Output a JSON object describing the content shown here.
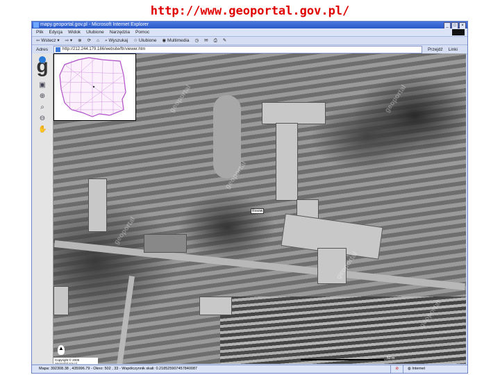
{
  "caption": "http://www.geoportal.gov.pl/",
  "window": {
    "title": "mapy.geoportal.gov.pl - Microsoft Internet Explorer",
    "controls": [
      "_",
      "□",
      "×"
    ]
  },
  "menu": [
    "Plik",
    "Edycja",
    "Widok",
    "Ulubione",
    "Narzędzia",
    "Pomoc"
  ],
  "toolbar": {
    "back": "Wstecz",
    "search": "Wyszukaj",
    "favorites": "Ulubione",
    "media": "Multimedia"
  },
  "address": {
    "label": "Adres",
    "url": "http://212.244.179.186/website/ftr/viewer.htm",
    "go": "Przejdź",
    "links": "Linki"
  },
  "map": {
    "place_label": "Rosow",
    "copyright": "Copyright © 2005 geoportal.gov.pl",
    "scale_label": "50 m",
    "watermark": "geoportal"
  },
  "status": {
    "text": "Mapa: 392308.38 , 435996.79 - Okno: 502 , 33 - Współczynnik skali: 0.218525907457840087",
    "zone": "Internet"
  }
}
